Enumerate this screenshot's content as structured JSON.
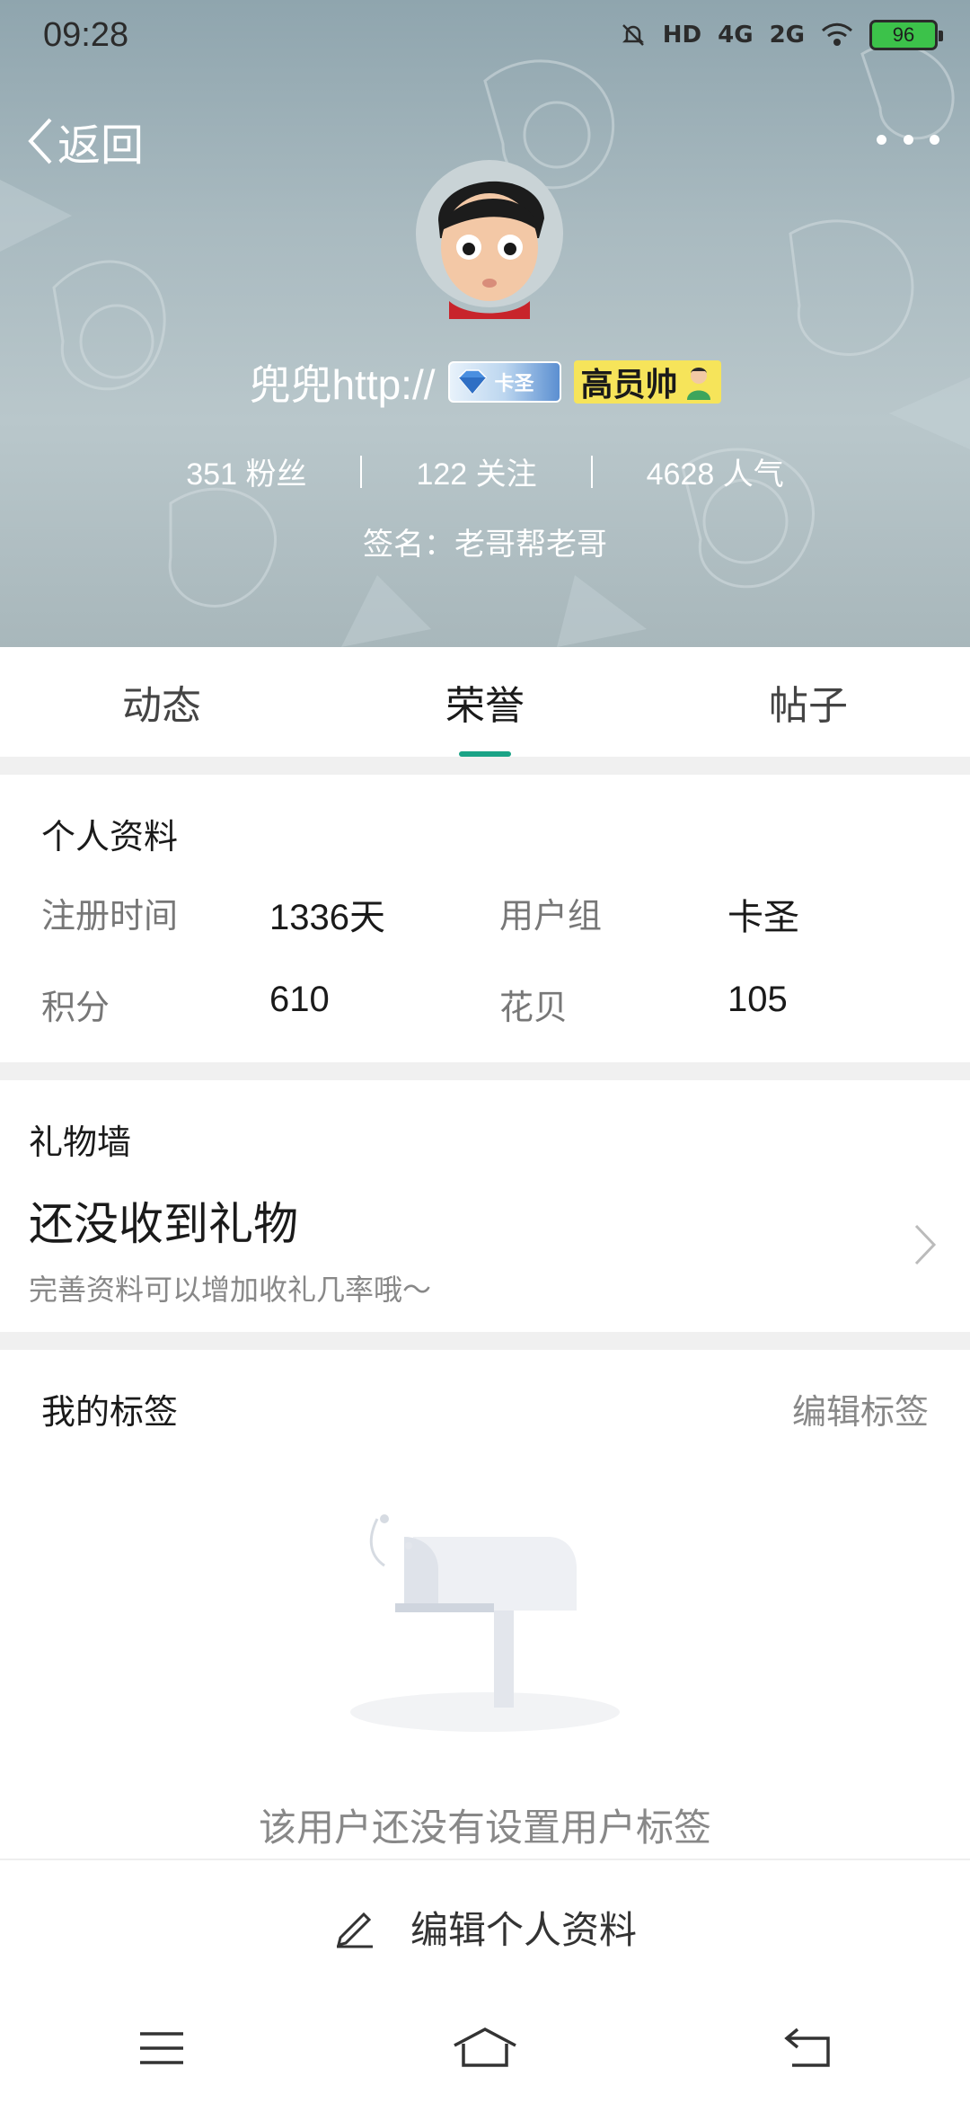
{
  "status_bar": {
    "time": "09:28",
    "icons": [
      "mute-icon",
      "hd-icon",
      "4g-signal-icon",
      "2g-signal-icon",
      "wifi-icon"
    ],
    "hd_label": "HD",
    "net1_label": "4G",
    "net2_label": "2G",
    "battery": "96",
    "battery_color": "#3cc24a"
  },
  "header": {
    "back_label": "返回",
    "username": "兜兜http://",
    "badge_blue_text": "卡圣",
    "badge_gold_text": "高员帅",
    "stats": {
      "fans": "351 粉丝",
      "following": "122 关注",
      "popularity": "4628 人气"
    },
    "signature": "签名：老哥帮老哥"
  },
  "tabs": [
    {
      "label": "动态",
      "active": false
    },
    {
      "label": "荣誉",
      "active": true
    },
    {
      "label": "帖子",
      "active": false
    }
  ],
  "accent_color": "#1aa386",
  "profile": {
    "title": "个人资料",
    "register_label": "注册时间",
    "register_value": "1336天",
    "group_label": "用户组",
    "group_value": "卡圣",
    "points_label": "积分",
    "points_value": "610",
    "flower_label": "花贝",
    "flower_value": "105"
  },
  "gift_wall": {
    "title": "礼物墙",
    "empty_text": "还没收到礼物",
    "hint": "完善资料可以增加收礼几率哦～"
  },
  "tags": {
    "title": "我的标签",
    "edit_label": "编辑标签",
    "empty_text": "该用户还没有设置用户标签"
  },
  "edit_bar": {
    "label": "编辑个人资料"
  },
  "navbar": {
    "icons": [
      "menu-icon",
      "home-icon",
      "back-nav-icon"
    ]
  }
}
